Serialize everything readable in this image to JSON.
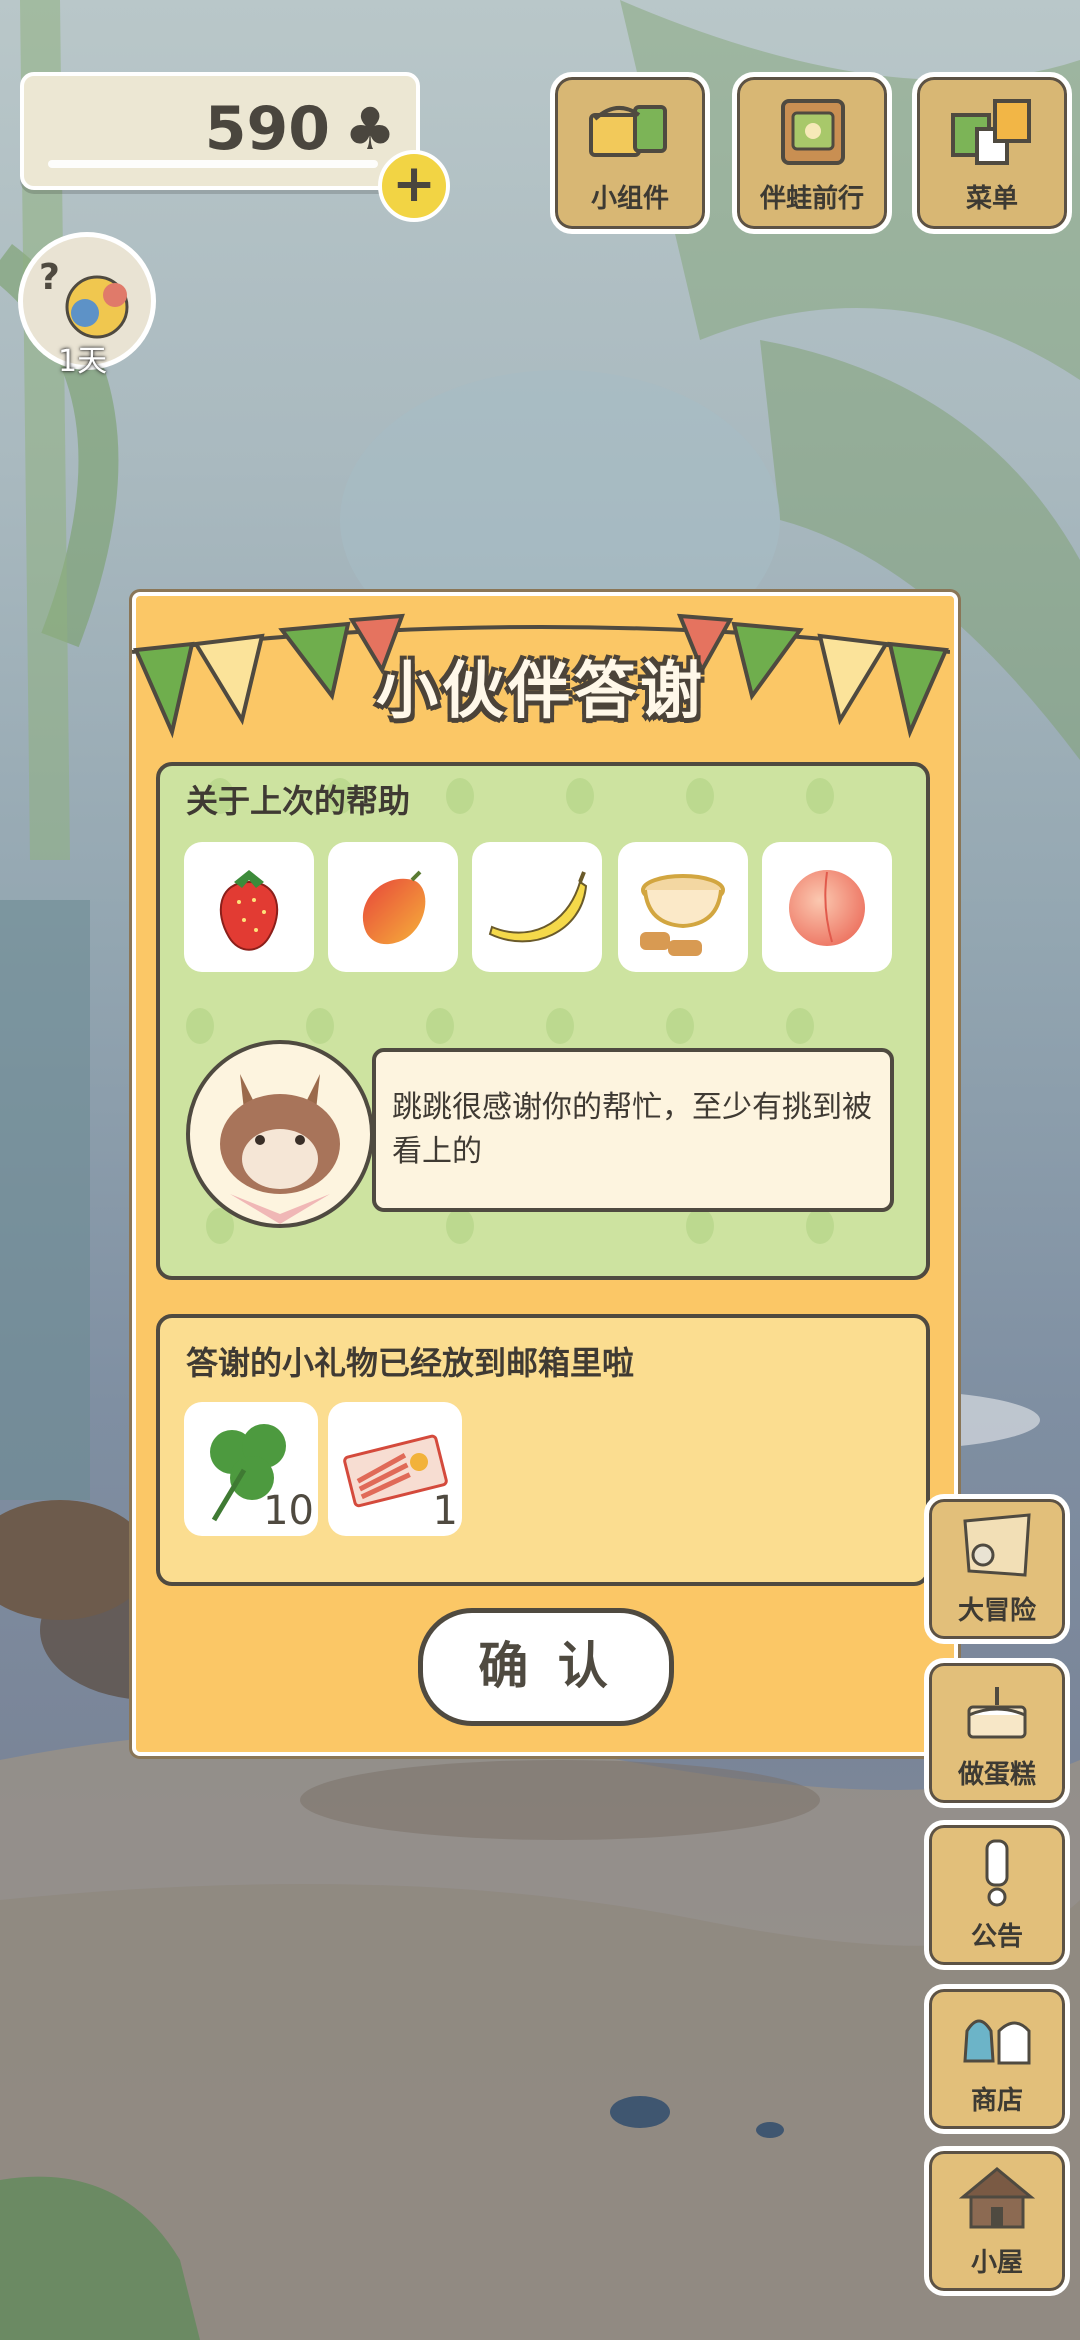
{
  "top_bar": {
    "clover_count": "590",
    "clover_symbol": "♣",
    "add_symbol": "+",
    "buttons": [
      {
        "label": "小组件",
        "icon": "widget-icon"
      },
      {
        "label": "伴蛙前行",
        "icon": "frog-journey-icon"
      },
      {
        "label": "菜单",
        "icon": "menu-icon"
      }
    ]
  },
  "avatar": {
    "day_label": "1天",
    "question": "?"
  },
  "dialog": {
    "title": "小伙伴答谢",
    "help_heading": "关于上次的帮助",
    "help_items": [
      "strawberry-icon",
      "mango-icon",
      "banana-icon",
      "tea-and-snacks-icon",
      "peach-icon"
    ],
    "speech": "跳跳很感谢你的帮忙，至少有挑到被看上的",
    "gift_heading": "答谢的小礼物已经放到邮箱里啦",
    "gifts": [
      {
        "icon": "clover-icon",
        "count": "10"
      },
      {
        "icon": "ticket-icon",
        "count": "1"
      }
    ],
    "confirm_label": "确 认"
  },
  "side_buttons": [
    {
      "label": "大冒险",
      "icon": "map-icon"
    },
    {
      "label": "做蛋糕",
      "icon": "cake-icon"
    },
    {
      "label": "公告",
      "icon": "exclamation-icon"
    },
    {
      "label": "商店",
      "icon": "bags-icon"
    },
    {
      "label": "小屋",
      "icon": "house-icon"
    }
  ],
  "colors": {
    "dialog_bg": "#fbc766",
    "help_panel": "#cde3a0",
    "gift_panel": "#fbdd90",
    "outline": "#4f4a40",
    "bunting_green": "#6fae4d",
    "bunting_red": "#e5735f"
  }
}
